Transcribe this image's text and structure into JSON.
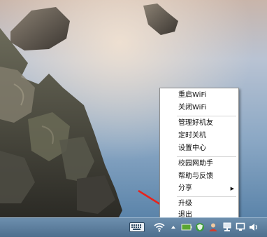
{
  "context_menu": {
    "items": [
      {
        "label": "重启WiFi"
      },
      {
        "label": "关闭WiFi"
      },
      {
        "label": "管理好机友"
      },
      {
        "label": "定时关机"
      },
      {
        "label": "设置中心"
      },
      {
        "label": "校园网助手"
      },
      {
        "label": "帮助与反馈"
      },
      {
        "label": "分享",
        "submenu_arrow": "▶"
      },
      {
        "label": "升级"
      },
      {
        "label": "退出"
      }
    ]
  },
  "taskbar": {
    "tray_icons": [
      "keyboard-icon",
      "wifi-icon",
      "show-hidden-icons-icon",
      "battery-icon",
      "security-shield-icon",
      "user-icon",
      "network-icon",
      "display-icon",
      "volume-icon"
    ]
  },
  "colors": {
    "annotation_arrow": "#e8231c",
    "menu_background": "#ffffff",
    "taskbar": "#5b7c9c"
  }
}
